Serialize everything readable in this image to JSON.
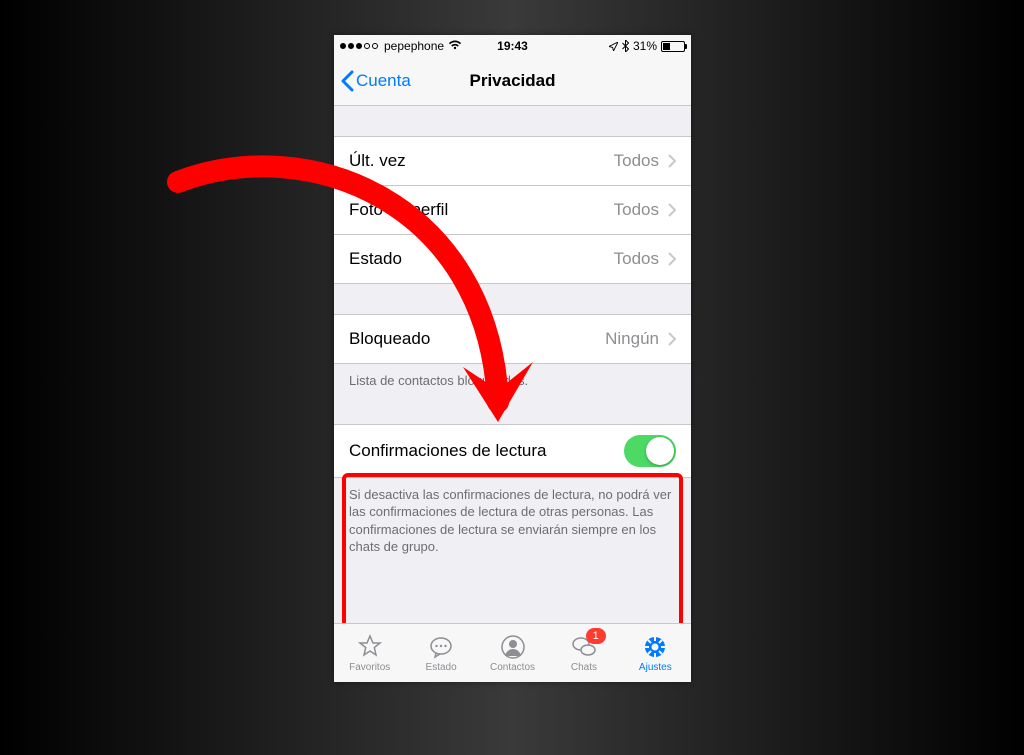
{
  "statusbar": {
    "carrier": "pepephone",
    "time": "19:43",
    "battery_text": "31%"
  },
  "nav": {
    "back_label": "Cuenta",
    "title": "Privacidad"
  },
  "rows": {
    "last_seen": {
      "label": "Últ. vez",
      "value": "Todos"
    },
    "profile_photo": {
      "label": "Foto de perfil",
      "value": "Todos"
    },
    "status": {
      "label": "Estado",
      "value": "Todos"
    },
    "blocked": {
      "label": "Bloqueado",
      "value": "Ningún"
    }
  },
  "blocked_footer": "Lista de contactos bloqueados.",
  "read_receipts": {
    "label": "Confirmaciones de lectura",
    "footer": "Si desactiva las confirmaciones de lectura, no podrá ver las confirmaciones de lectura de otras personas. Las confirmaciones de lectura se enviarán siempre en los chats de grupo."
  },
  "tabs": {
    "favorites": "Favoritos",
    "status": "Estado",
    "contacts": "Contactos",
    "chats": "Chats",
    "chats_badge": "1",
    "settings": "Ajustes"
  }
}
